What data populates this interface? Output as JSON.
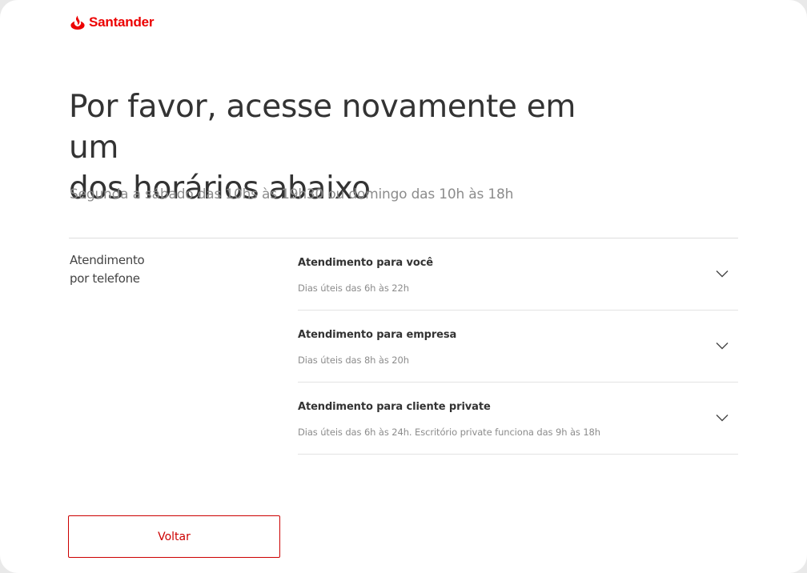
{
  "brand": {
    "name": "Santander",
    "color": "#ec0000",
    "logo_icon": "flame-icon"
  },
  "main": {
    "title_line1": "Por favor, acesse novamente em um",
    "title_line2": "dos horários abaixo",
    "subtitle": "Segunda a sábado das 10hs às 19h30 ou domingo das 10h às 18h"
  },
  "phone_section": {
    "label_line1": "Atendimento",
    "label_line2": "por telefone",
    "items": [
      {
        "title": "Atendimento para você",
        "description": "Dias úteis das 6h às 22h",
        "icon": "chevron-down-icon"
      },
      {
        "title": "Atendimento para empresa",
        "description": "Dias úteis das 8h às 20h",
        "icon": "chevron-down-icon"
      },
      {
        "title": "Atendimento para cliente private",
        "description": "Dias úteis das 6h às 24h. Escritório private funciona das 9h às 18h",
        "icon": "chevron-down-icon"
      }
    ]
  },
  "actions": {
    "back_label": "Voltar",
    "accent_color": "#cc0000"
  }
}
